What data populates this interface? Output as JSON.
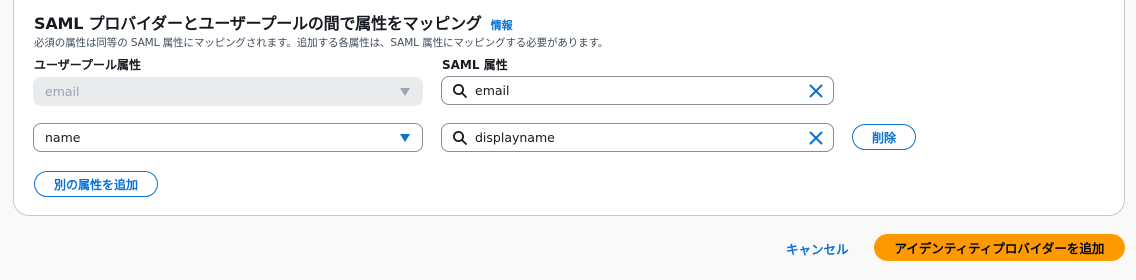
{
  "section": {
    "title": "SAML プロバイダーとユーザープールの間で属性をマッピング",
    "info_link": "情報",
    "description": "必須の属性は同等の SAML 属性にマッピングされます。追加する各属性は、SAML 属性にマッピングする必要があります。"
  },
  "columns": {
    "user_pool_attribute": "ユーザープール属性",
    "saml_attribute": "SAML 属性"
  },
  "mappings": [
    {
      "user_pool_attribute": "email",
      "saml_attribute": "email",
      "required": true
    },
    {
      "user_pool_attribute": "name",
      "saml_attribute": "displayname",
      "remove_label": "削除"
    }
  ],
  "buttons": {
    "add_attribute": "別の属性を追加",
    "cancel": "キャンセル",
    "add_identity_provider": "アイデンティティプロバイダーを追加"
  },
  "icons": {
    "search": "search-icon",
    "clear": "close-icon",
    "dropdown": "caret-down-icon"
  },
  "colors": {
    "accent": "#0972d3",
    "primary_button": "#ff9900",
    "disabled_bg": "#e9ebed"
  }
}
